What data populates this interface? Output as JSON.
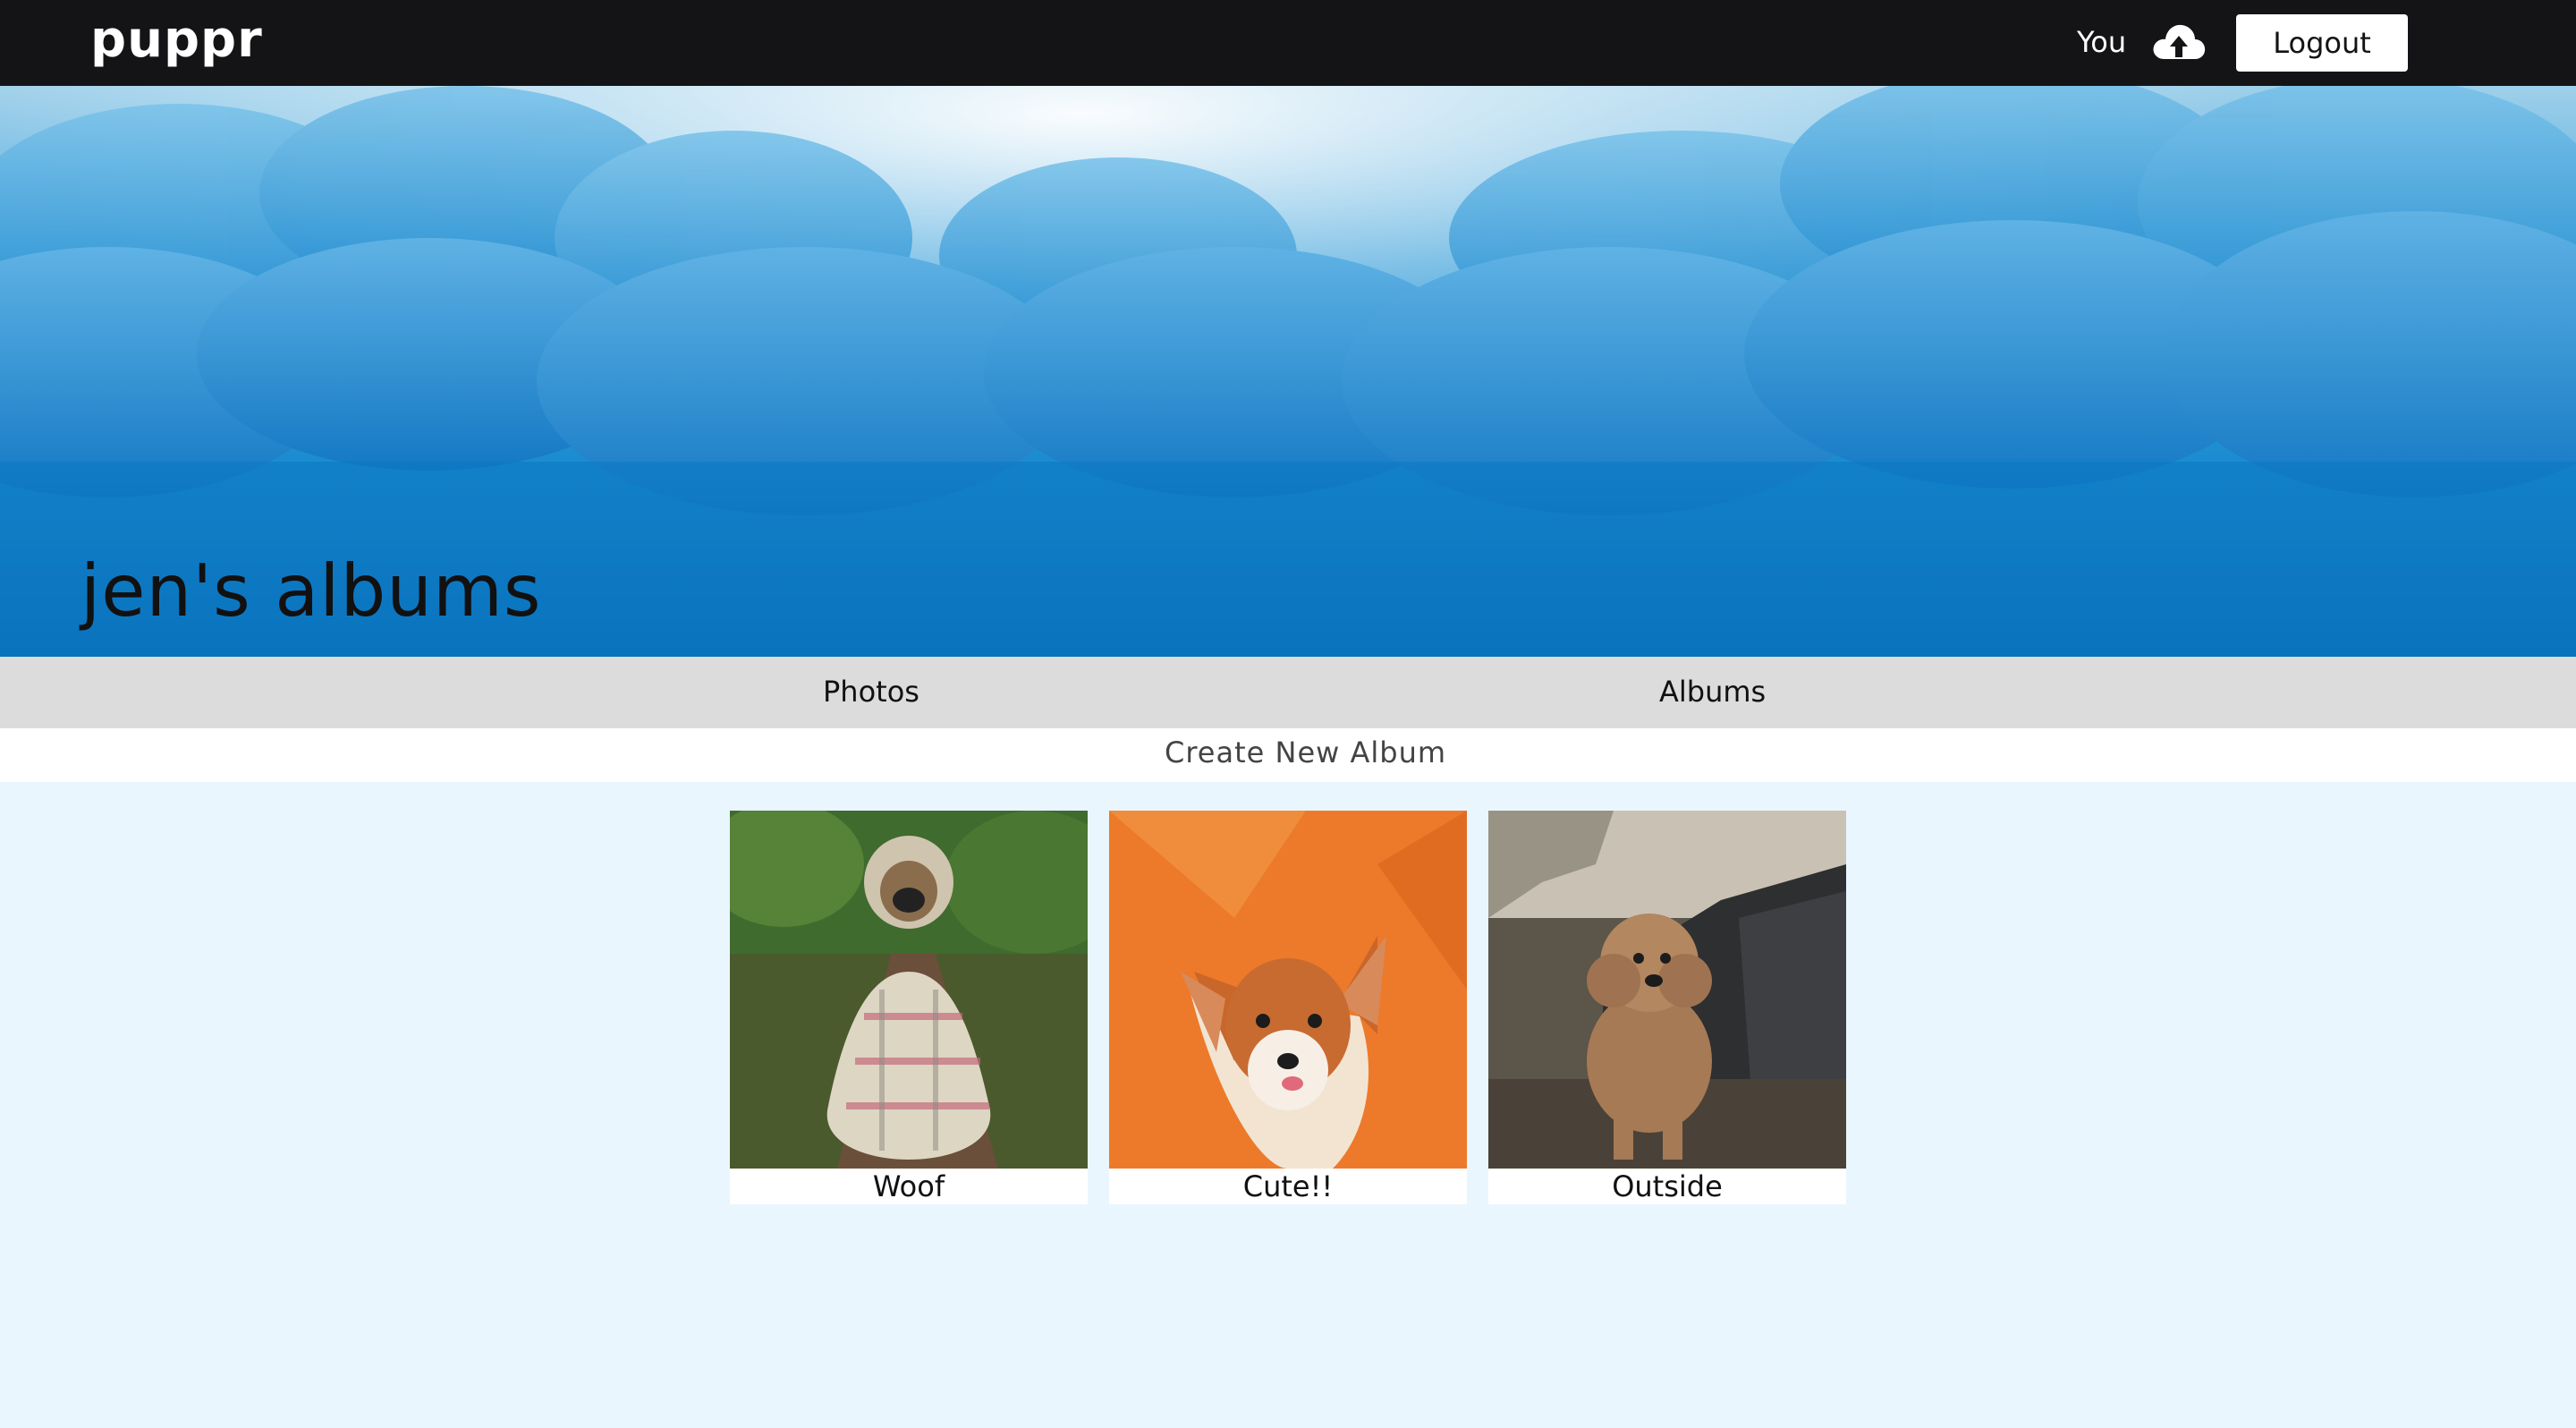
{
  "nav": {
    "logo": "puppr",
    "user_link": "You",
    "upload_icon": "cloud-upload-icon",
    "logout_label": "Logout"
  },
  "hero": {
    "title": "jen's albums"
  },
  "tabs": [
    {
      "label": "Photos"
    },
    {
      "label": "Albums"
    }
  ],
  "create_album_label": "Create New Album",
  "albums": [
    {
      "title": "Woof"
    },
    {
      "title": "Cute!!"
    },
    {
      "title": "Outside"
    }
  ],
  "colors": {
    "nav_bg": "#141416",
    "page_bg": "#eaf6fd",
    "tabs_bg": "#dcdcdc"
  }
}
